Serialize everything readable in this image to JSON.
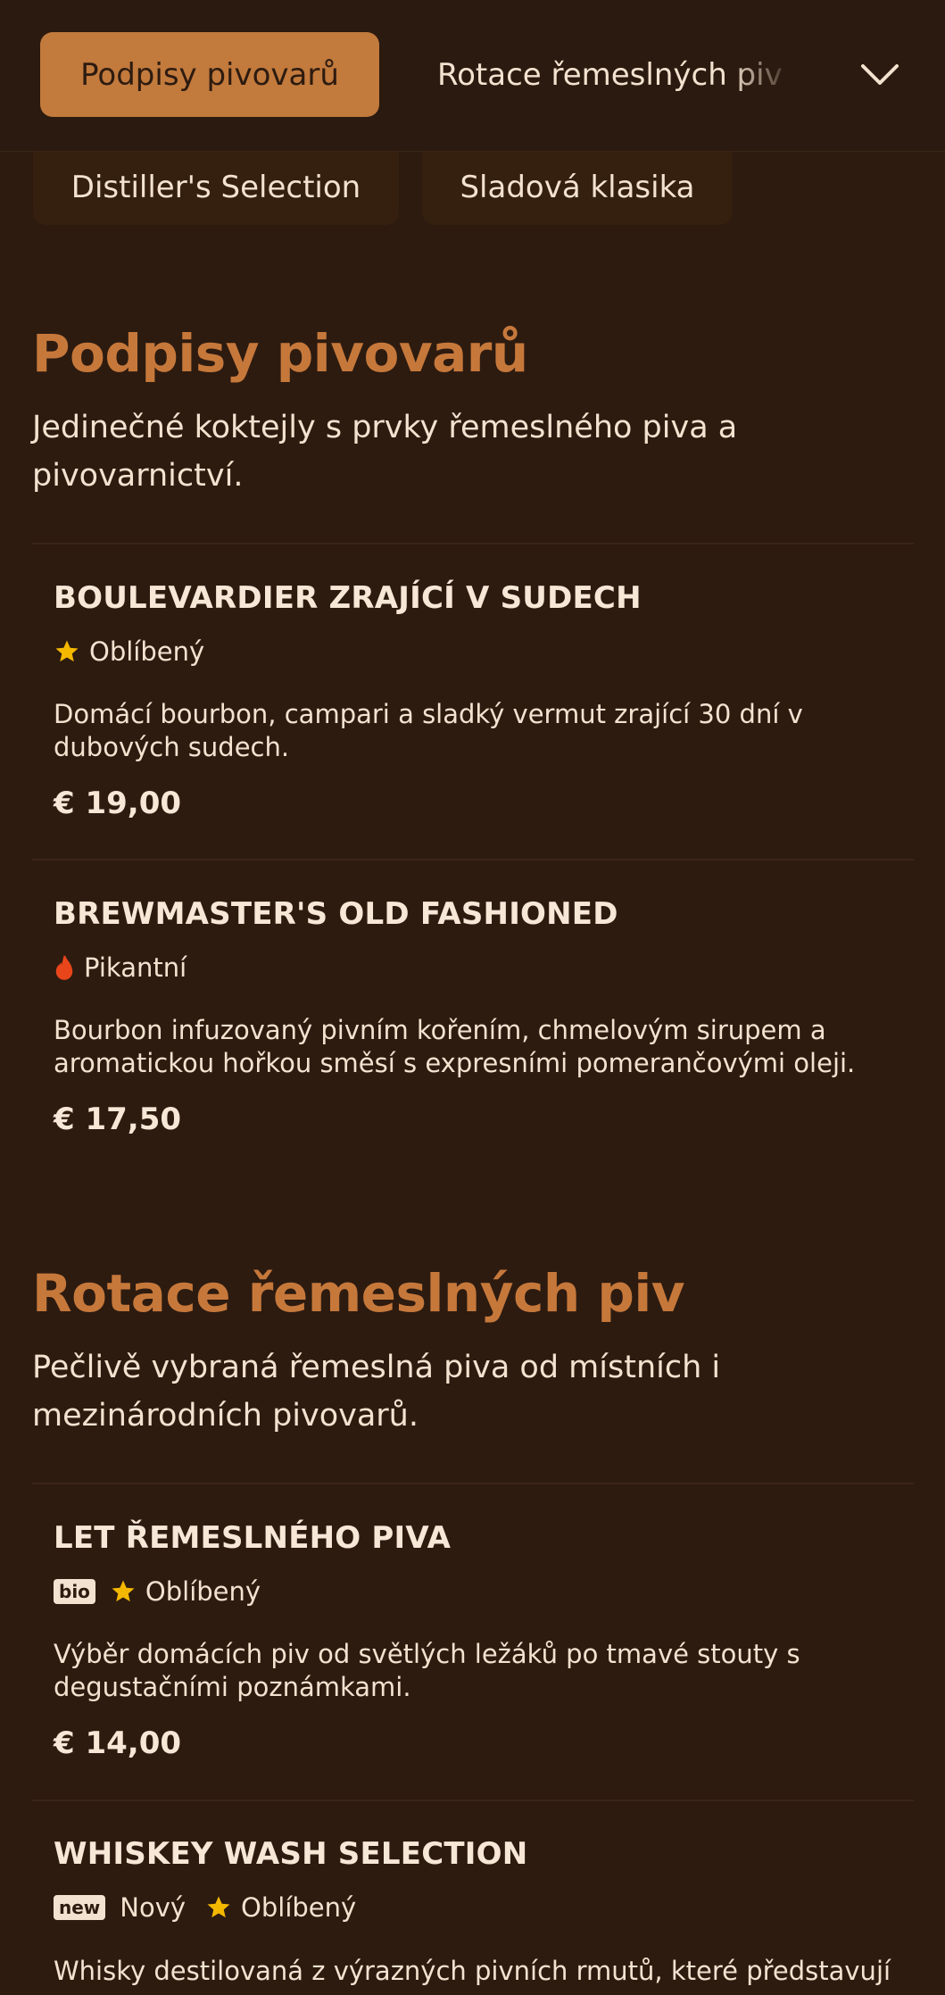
{
  "tabs": {
    "active": "Podpisy pivovarů",
    "next": "Rotace řemeslných piv",
    "more_icon": "chevron-down-icon"
  },
  "pills": [
    "Distiller's Selection",
    "Sladová klasika"
  ],
  "colors": {
    "background": "#2d1b10",
    "accent": "#c27a3d",
    "text": "#f3e2cf",
    "star": "#f5b800",
    "fire": "#e8461a"
  },
  "sections": [
    {
      "title": "Podpisy pivovarů",
      "description": "Jedinečné koktejly s prvky řemeslného piva a pivovarnictví.",
      "items": [
        {
          "name": "BOULEVARDIER ZRAJÍCÍ V SUDECH",
          "tags": [
            {
              "icon": "star-icon",
              "label": "Oblíbený"
            }
          ],
          "description": "Domácí bourbon, campari a sladký vermut zrající 30 dní v dubových sudech.",
          "price": "€ 19,00"
        },
        {
          "name": "BREWMASTER'S OLD FASHIONED",
          "tags": [
            {
              "icon": "fire-icon",
              "label": "Pikantní"
            }
          ],
          "description": "Bourbon infuzovaný pivním kořením, chmelovým sirupem a aromatickou hořkou směsí s expresními pomerančovými oleji.",
          "price": "€ 17,50"
        }
      ]
    },
    {
      "title": "Rotace řemeslných piv",
      "description": "Pečlivě vybraná řemeslná piva od místních i mezinárodních pivovarů.",
      "items": [
        {
          "name": "LET ŘEMESLNÉHO PIVA",
          "badge": "bio",
          "tags": [
            {
              "icon": "star-icon",
              "label": "Oblíbený"
            }
          ],
          "description": "Výběr domácích piv od světlých ležáků po tmavé stouty s degustačními poznámkami.",
          "price": "€ 14,00"
        },
        {
          "name": "WHISKEY WASH SELECTION",
          "badge": "new",
          "tags": [
            {
              "icon": "none",
              "label": "Nový"
            },
            {
              "icon": "star-icon",
              "label": "Oblíbený"
            }
          ],
          "description": "Whisky destilovaná z výrazných pivních rmutů, které představují"
        }
      ]
    }
  ]
}
